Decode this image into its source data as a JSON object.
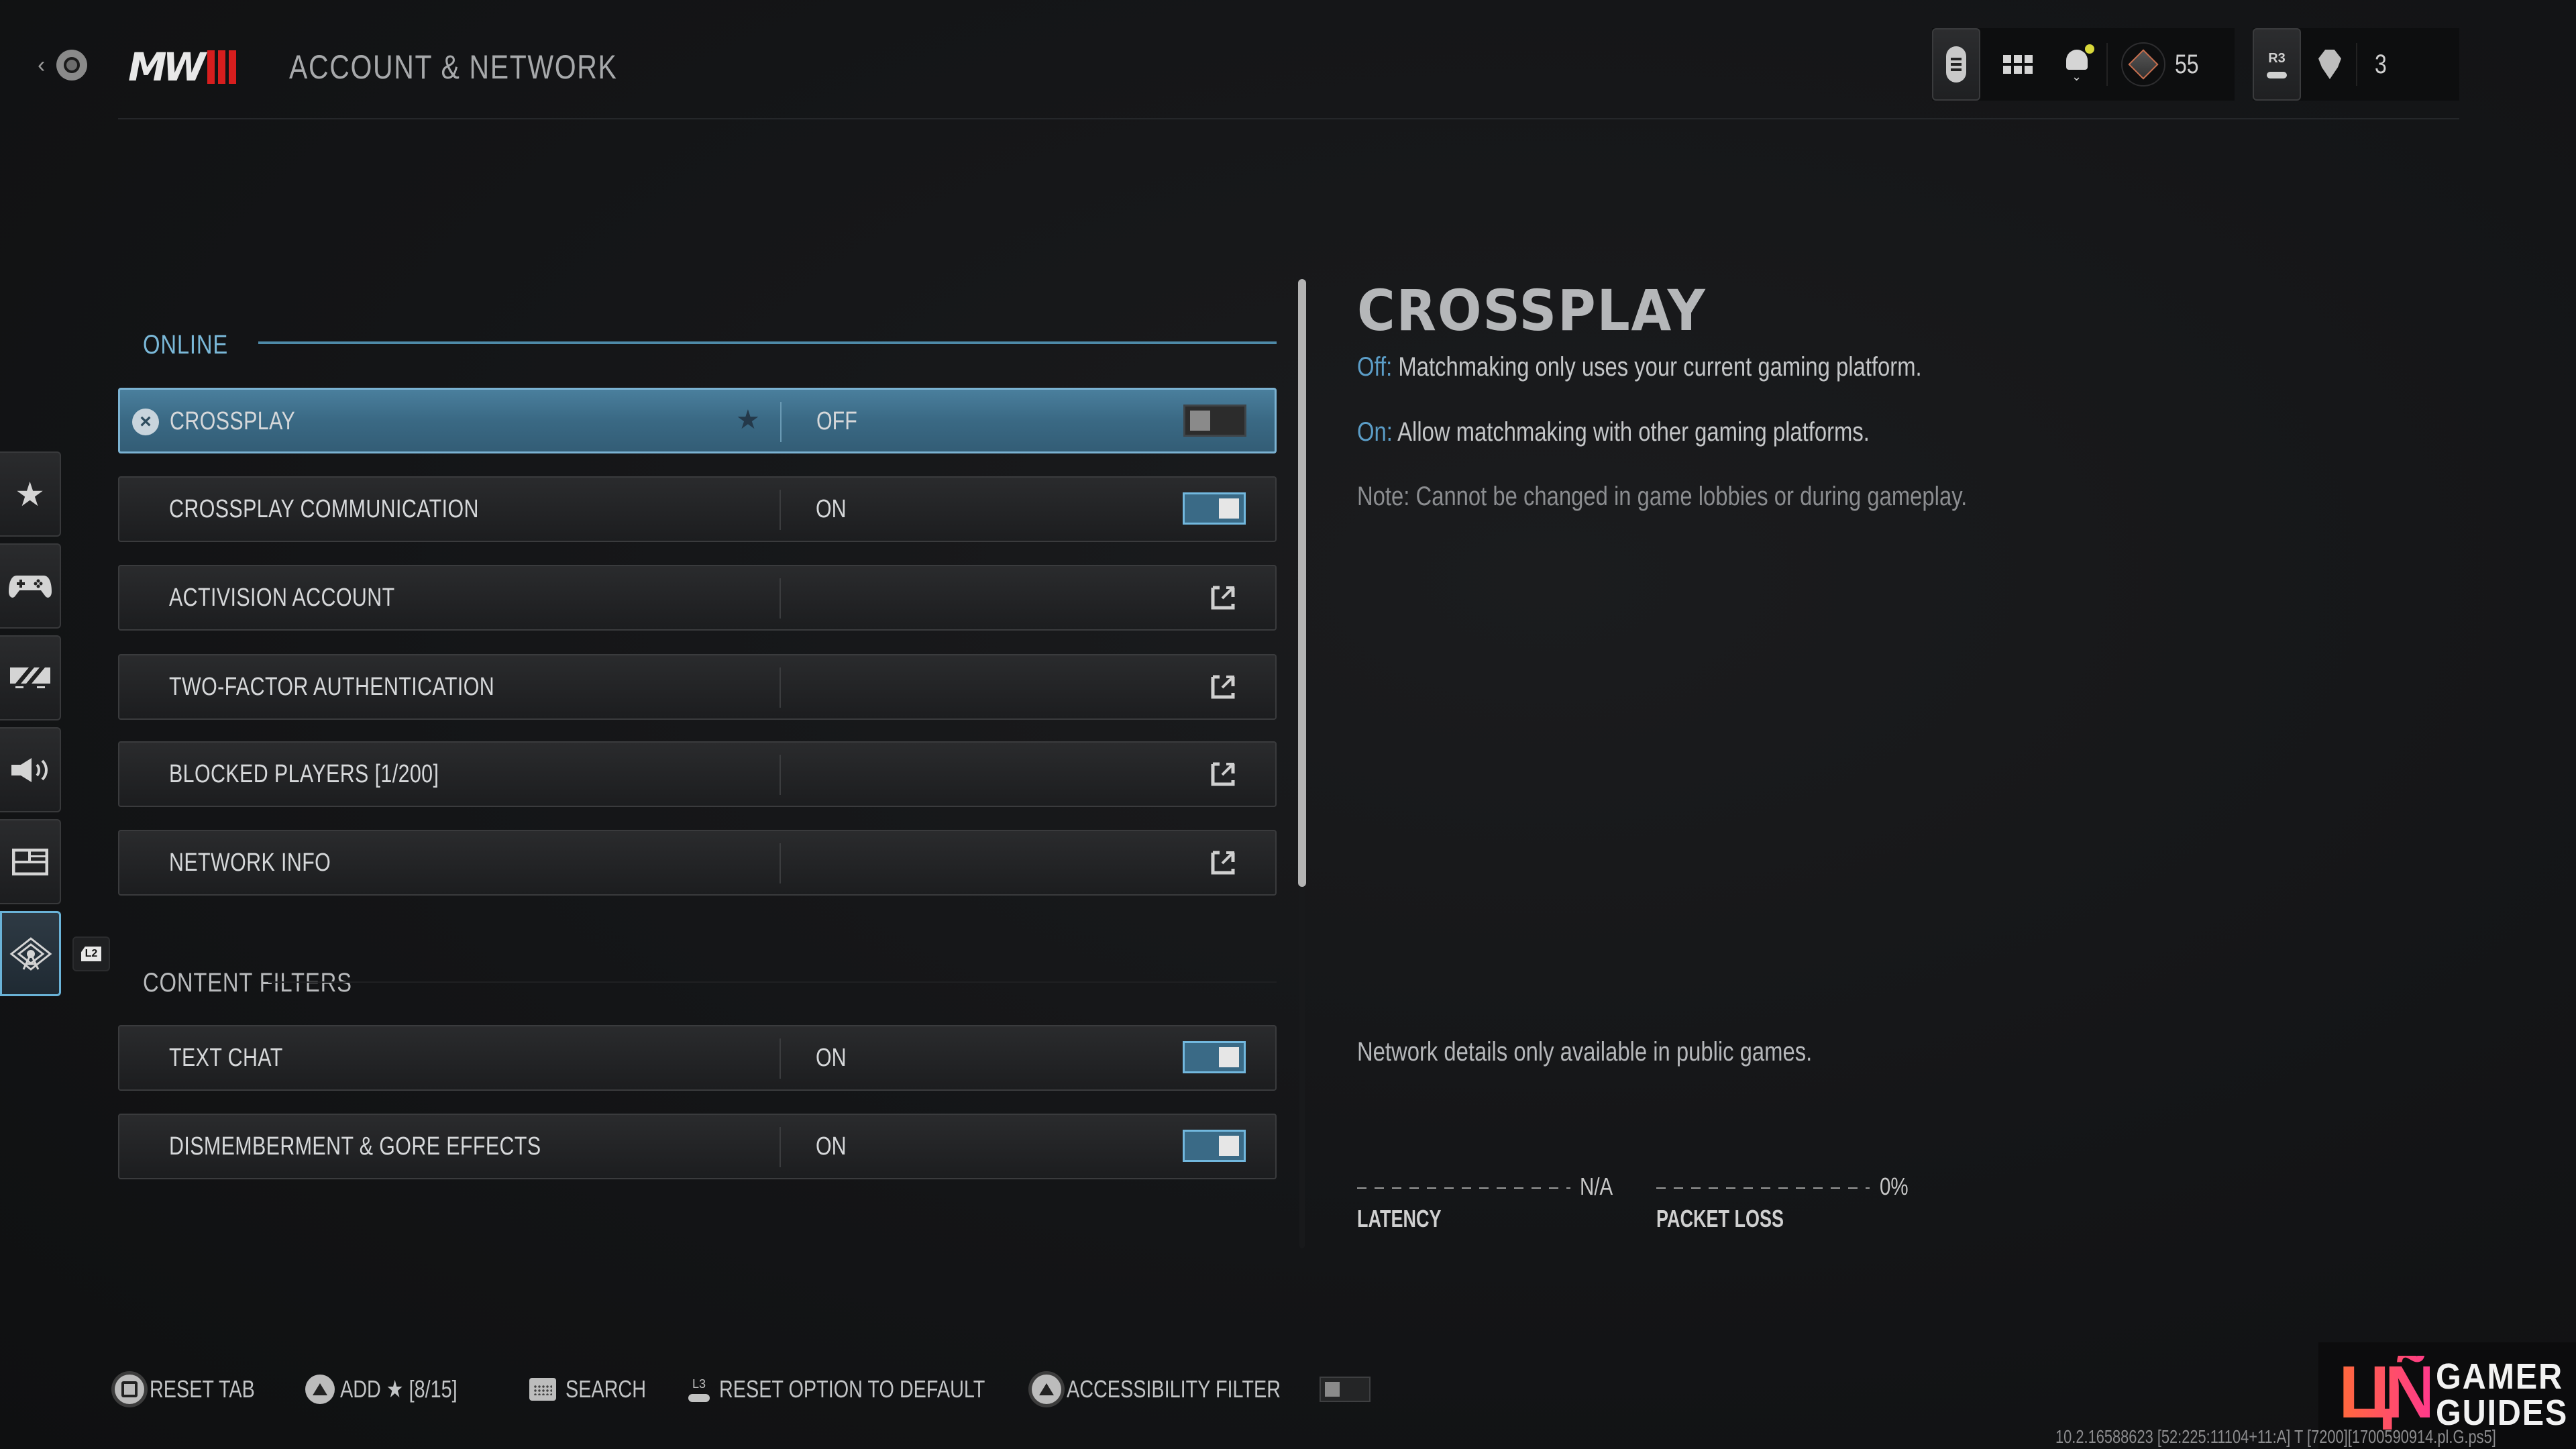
{
  "header": {
    "back_hint": "back",
    "logo_text": "MW",
    "title": "ACCOUNT & NETWORK"
  },
  "top_right": {
    "rank_level": "55",
    "party_count": "3",
    "r3_label": "R3",
    "notification_dot_color": "#d8d83a"
  },
  "sidebar": {
    "items": [
      {
        "icon": "star-icon",
        "label": "favorites",
        "glyph": "★"
      },
      {
        "icon": "controller-icon",
        "label": "controller",
        "glyph": "🎮"
      },
      {
        "icon": "graphics-icon",
        "label": "graphics",
        "glyph": "▰"
      },
      {
        "icon": "audio-icon",
        "label": "audio",
        "glyph": "🔊"
      },
      {
        "icon": "interface-icon",
        "label": "interface",
        "glyph": "▤"
      },
      {
        "icon": "network-icon",
        "label": "account-network",
        "glyph": "⌬",
        "active": true
      }
    ],
    "tab_hint": "L2"
  },
  "sections": {
    "online": {
      "label": "ONLINE",
      "rows": [
        {
          "label": "CROSSPLAY",
          "value": "OFF",
          "control": "toggle",
          "on": false,
          "selected": true,
          "favorited": true
        },
        {
          "label": "CROSSPLAY COMMUNICATION",
          "value": "ON",
          "control": "toggle",
          "on": true
        },
        {
          "label": "ACTIVISION ACCOUNT",
          "control": "external"
        },
        {
          "label": "TWO-FACTOR AUTHENTICATION",
          "control": "external"
        },
        {
          "label": "BLOCKED PLAYERS [1/200]",
          "control": "external"
        },
        {
          "label": "NETWORK INFO",
          "control": "external"
        }
      ]
    },
    "content_filters": {
      "label": "CONTENT FILTERS",
      "rows": [
        {
          "label": "TEXT CHAT",
          "value": "ON",
          "control": "toggle",
          "on": true
        },
        {
          "label": "DISMEMBERMENT & GORE EFFECTS",
          "value": "ON",
          "control": "toggle",
          "on": true
        }
      ]
    }
  },
  "description": {
    "title": "CROSSPLAY",
    "off_key": "Off:",
    "off_text": " Matchmaking only uses your current gaming platform.",
    "on_key": "On:",
    "on_text": " Allow matchmaking with other gaming platforms.",
    "note": "Note: Cannot be changed in game lobbies or during gameplay."
  },
  "network": {
    "info": "Network details only available in public games.",
    "latency_label": "LATENCY",
    "latency_value": "N/A",
    "packet_loss_label": "PACKET LOSS",
    "packet_loss_value": "0%"
  },
  "bottom_bar": {
    "reset_tab": "RESET TAB",
    "add_fav": "ADD ★ [8/15]",
    "search": "SEARCH",
    "l3_label": "L3",
    "reset_default": "RESET OPTION TO DEFAULT",
    "accessibility_filter": "ACCESSIBILITY FILTER",
    "accessibility_filter_on": false
  },
  "watermark": {
    "glyph": "ЦÑ",
    "line1": "GAMER",
    "line2": "GUIDES"
  },
  "build_info": "10.2.16588623 [52:225:11104+11:A] T [7200][1700590914.pl.G.ps5]",
  "colors": {
    "accent": "#7ab8d8",
    "selected_row": "#3a6984",
    "toggle_on": "#3a6a86",
    "logo_red": "#d71e1e"
  }
}
